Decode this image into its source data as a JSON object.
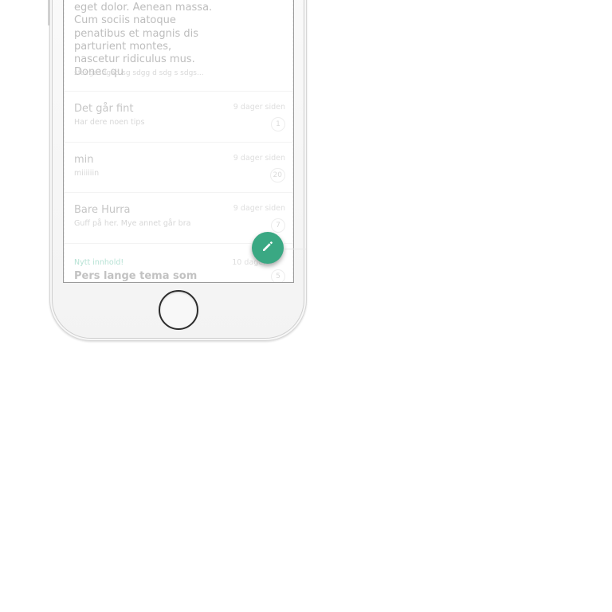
{
  "messages": {
    "first": {
      "body": "eget dolor. Aenean massa. Cum sociis natoque penatibus et magnis dis parturient montes, nascetur ridiculus mus. Donec qu",
      "subtext": "sfavgasdgad sg sdgg d sdg s sdgs..."
    },
    "threads": [
      {
        "title": "Det går fint",
        "subtitle": "Har dere noen tips",
        "time": "9 dager siden",
        "count": "1"
      },
      {
        "title": "min",
        "subtitle": "miiiiiin",
        "time": "9 dager siden",
        "count": "20"
      },
      {
        "title": "Bare Hurra",
        "subtitle": "Guff på her.  Mye annet går bra",
        "time": "9 dager siden",
        "count": "7"
      }
    ],
    "new_item": {
      "label": "Nytt innhold!",
      "title": "Pers lange tema som må",
      "time": "10 dager",
      "count": "5"
    }
  },
  "fab": {
    "icon": "pencil-icon",
    "color": "#3aa883"
  },
  "accent_new_color": "#8fd3bd"
}
